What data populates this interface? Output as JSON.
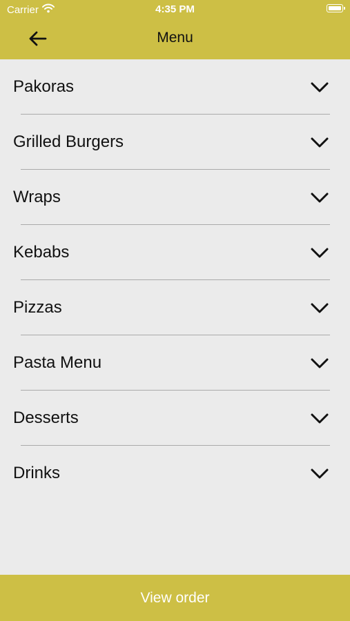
{
  "status_bar": {
    "carrier": "Carrier",
    "time": "4:35 PM",
    "icons": [
      "wifi-icon",
      "battery-icon"
    ]
  },
  "header": {
    "title": "Menu",
    "back_icon": "arrow-left-icon"
  },
  "menu": {
    "items": [
      {
        "label": "Pakoras",
        "icon": "chevron-down-icon"
      },
      {
        "label": "Grilled Burgers",
        "icon": "chevron-down-icon"
      },
      {
        "label": "Wraps",
        "icon": "chevron-down-icon"
      },
      {
        "label": "Kebabs",
        "icon": "chevron-down-icon"
      },
      {
        "label": "Pizzas",
        "icon": "chevron-down-icon"
      },
      {
        "label": "Pasta Menu",
        "icon": "chevron-down-icon"
      },
      {
        "label": "Desserts",
        "icon": "chevron-down-icon"
      },
      {
        "label": "Drinks",
        "icon": "chevron-down-icon"
      }
    ]
  },
  "footer": {
    "button_label": "View order"
  },
  "colors": {
    "accent": "#cdbf45",
    "background": "#ebebeb",
    "divider": "#a9a9a9"
  }
}
